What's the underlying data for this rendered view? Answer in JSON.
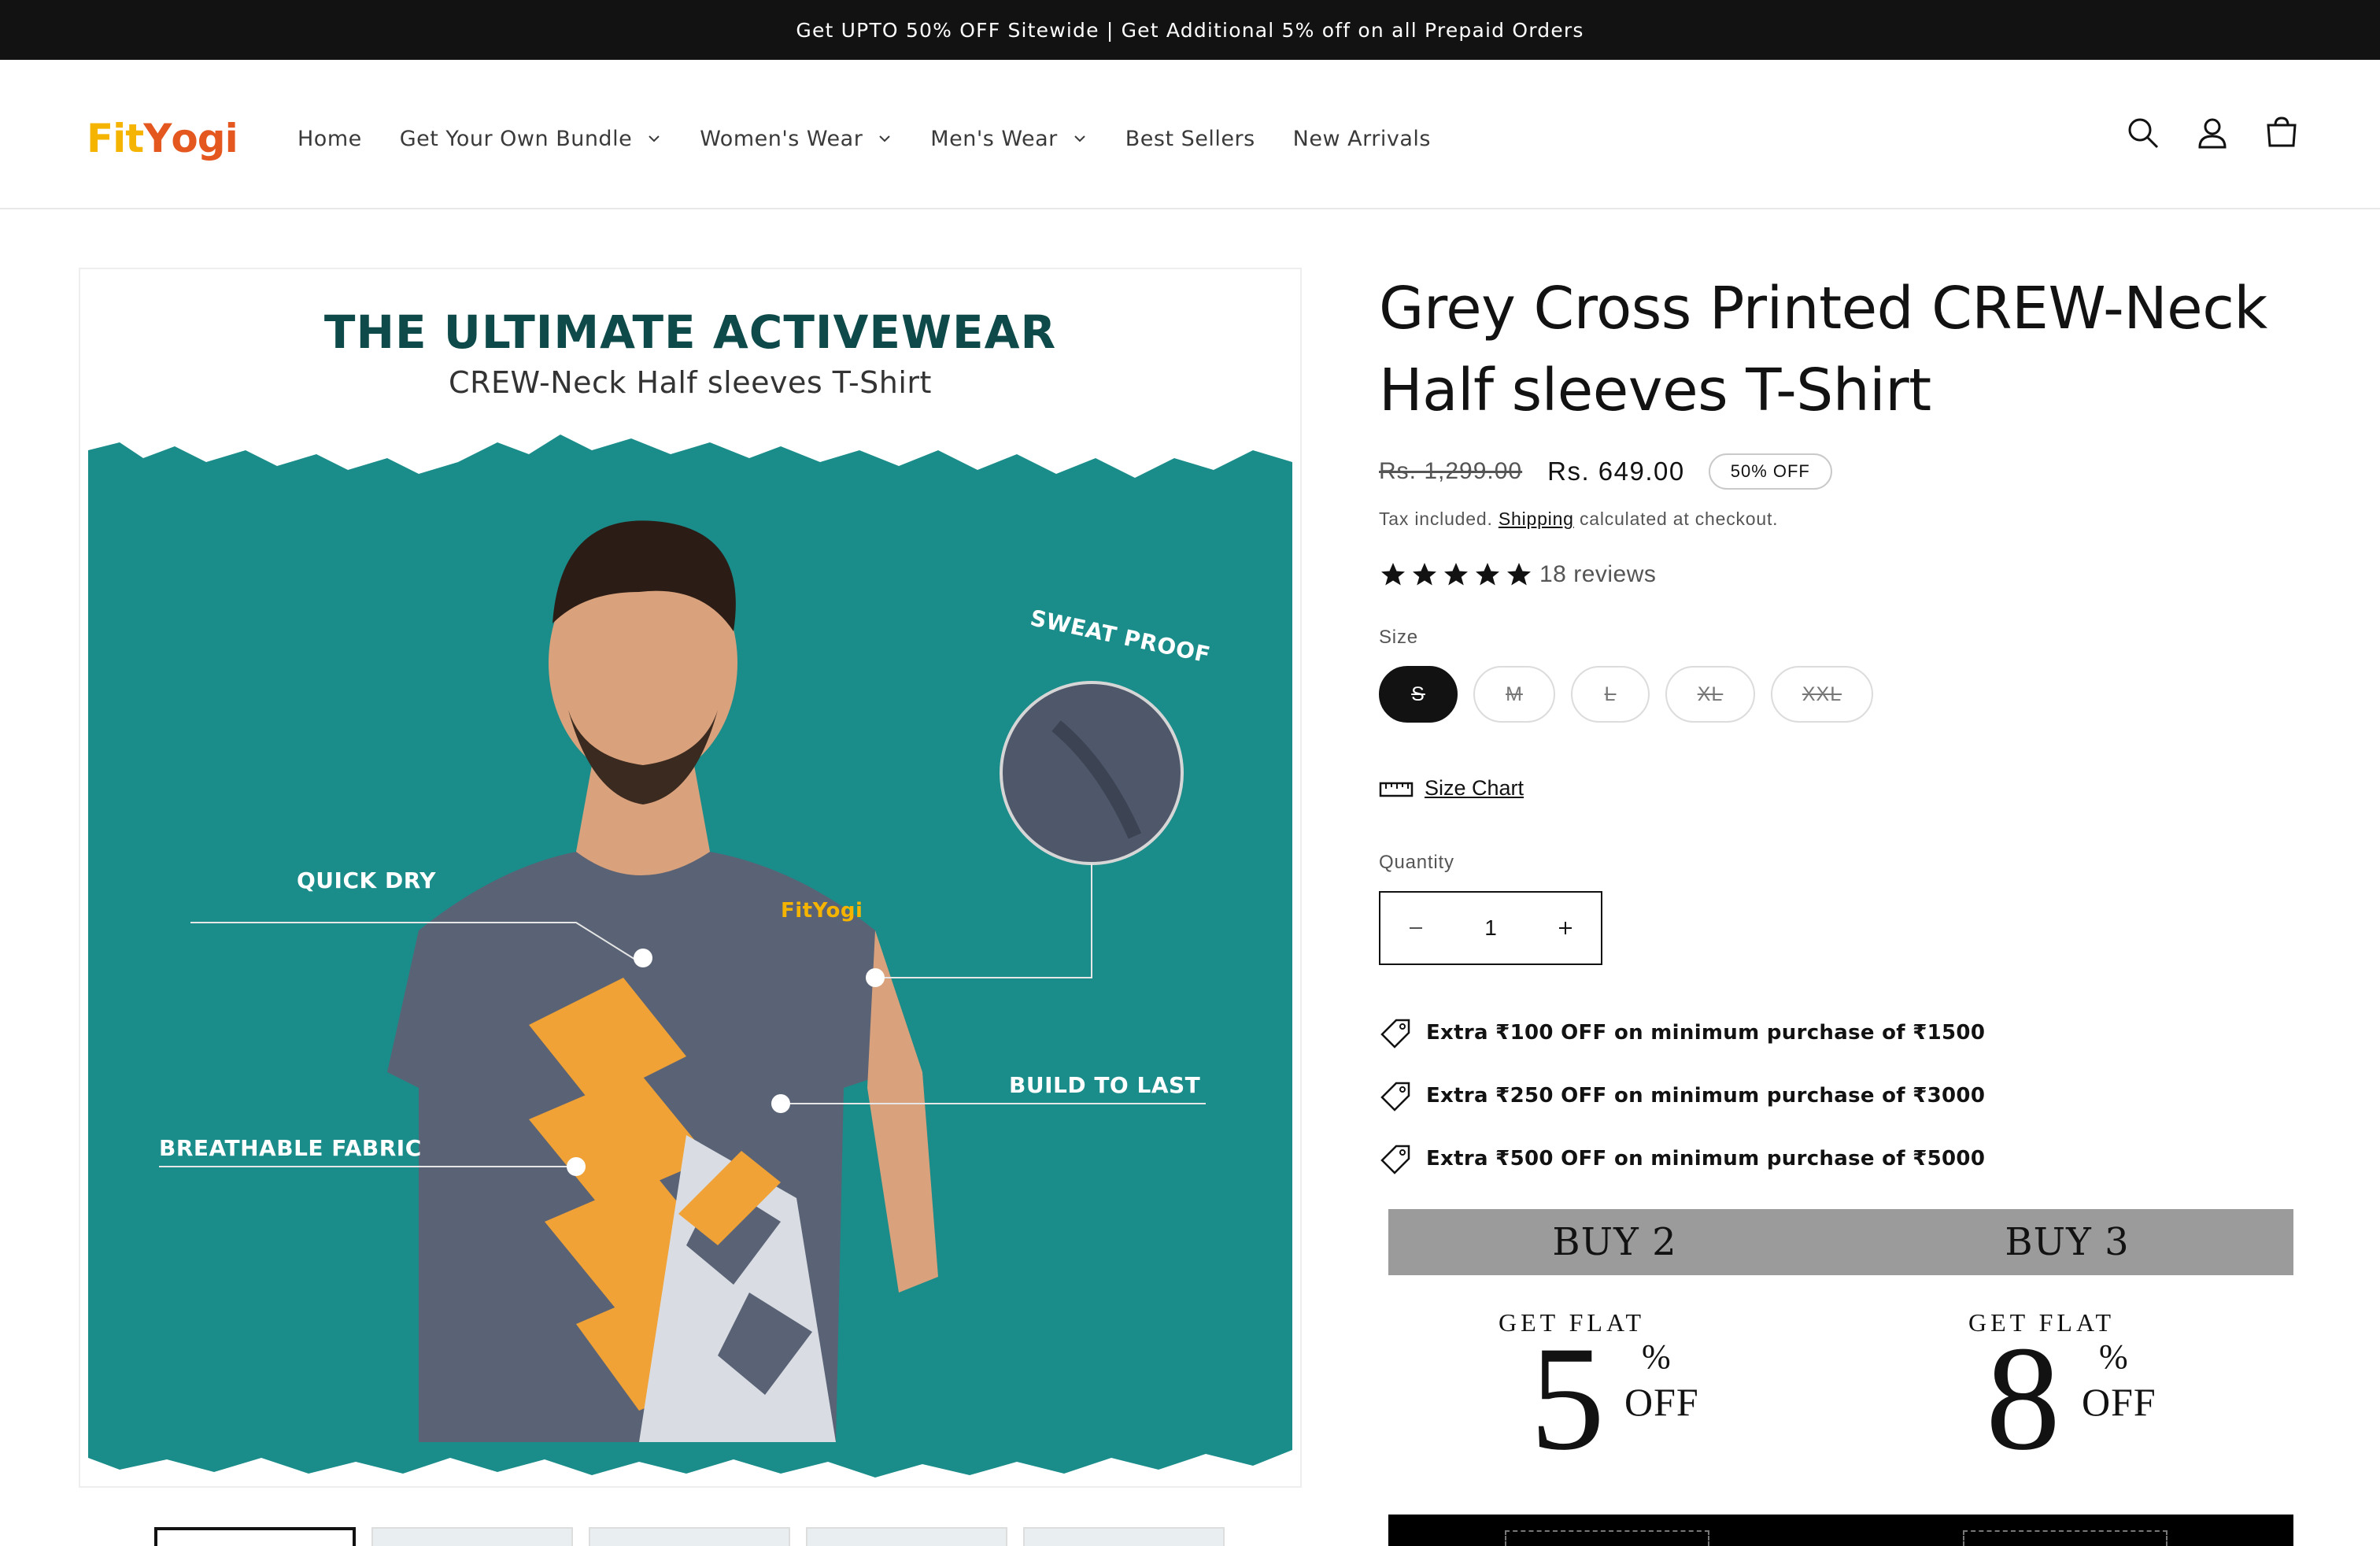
{
  "announcement": "Get UPTO 50% OFF Sitewide | Get Additional 5% off on all Prepaid Orders",
  "logo": {
    "part1": "Fit",
    "part2": "Y",
    "part3": "ogi"
  },
  "nav": [
    {
      "label": "Home",
      "dropdown": false
    },
    {
      "label": "Get Your Own Bundle",
      "dropdown": true
    },
    {
      "label": "Women's Wear",
      "dropdown": true
    },
    {
      "label": "Men's Wear",
      "dropdown": true
    },
    {
      "label": "Best Sellers",
      "dropdown": false
    },
    {
      "label": "New Arrivals",
      "dropdown": false
    }
  ],
  "header_icons": [
    "search-icon",
    "account-icon",
    "cart-icon"
  ],
  "hero": {
    "title": "THE ULTIMATE ACTIVEWEAR",
    "subtitle": "CREW-Neck Half sleeves T-Shirt",
    "features": [
      "SWEAT PROOF",
      "QUICK DRY",
      "BUILD TO LAST",
      "BREATHABLE FABRIC"
    ],
    "shirt_logo": "FitYogi",
    "teal": "#1a8c8a"
  },
  "product": {
    "title": "Grey Cross Printed CREW-Neck Half sleeves T-Shirt",
    "price_old": "Rs. 1,299.00",
    "price_new": "Rs. 649.00",
    "badge": "50% OFF",
    "tax_pre": "Tax included.",
    "tax_link": "Shipping",
    "tax_post": "calculated at checkout.",
    "rating": 5,
    "reviews": "18 reviews",
    "size_label": "Size",
    "sizes": [
      "S",
      "M",
      "L",
      "XL",
      "XXL"
    ],
    "selected_size": "S",
    "size_chart": "Size Chart",
    "quantity_label": "Quantity",
    "quantity": "1",
    "offers": [
      "Extra ₹100 OFF on minimum purchase of ₹1500",
      "Extra ₹250 OFF on minimum purchase of ₹3000",
      "Extra ₹500 OFF on minimum purchase of ₹5000"
    ]
  },
  "bundle": {
    "buy2": "BUY 2",
    "buy3": "BUY 3",
    "get_flat": "GET FLAT",
    "deal1_num": "5",
    "deal2_num": "8",
    "pct": "%",
    "off": "OFF"
  }
}
